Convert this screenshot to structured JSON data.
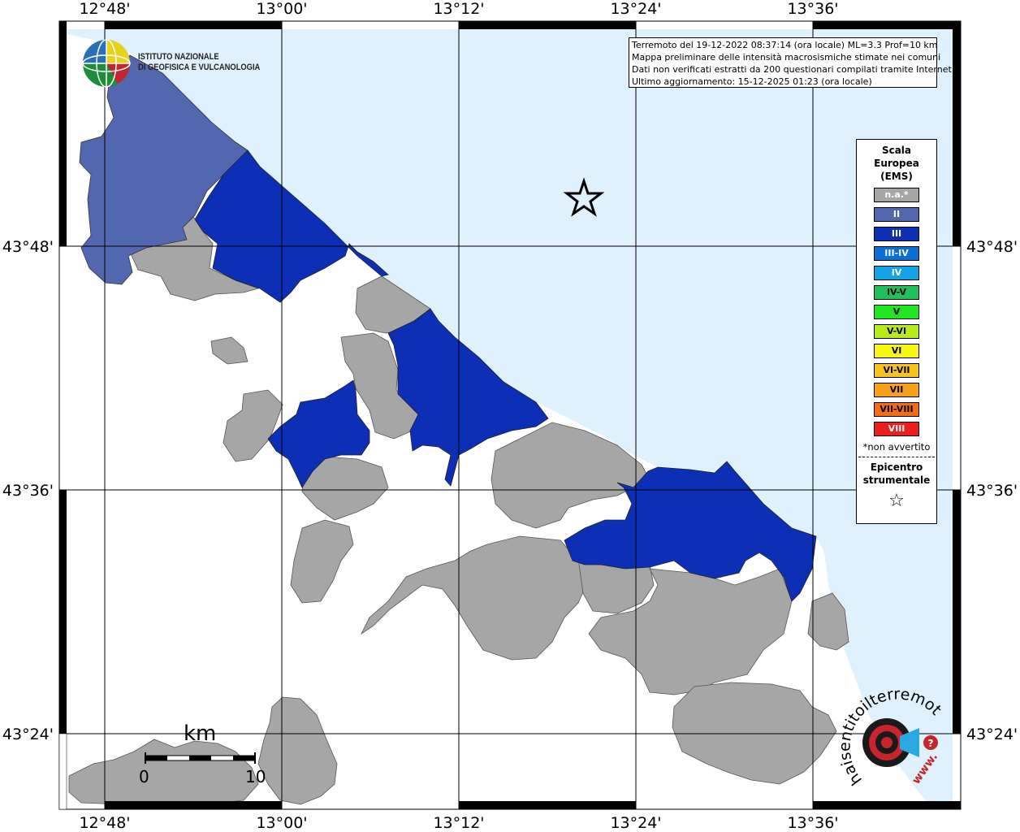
{
  "map": {
    "lon_labels": [
      "12°48'",
      "13°00'",
      "13°12'",
      "13°24'",
      "13°36'"
    ],
    "lat_labels": [
      "43°48'",
      "43°36'",
      "43°24'"
    ],
    "colors": {
      "sea": "#dff1fc",
      "na_fill": "#a6a6a6",
      "ii_fill": "#5366b0",
      "iii_fill": "#0d2fb5",
      "frame": "#000000"
    }
  },
  "logo": {
    "line1": "ISTITUTO NAZIONALE",
    "line2": "DI GEOFISICA E VULCANOLOGIA"
  },
  "info": {
    "line1": "Terremoto del 19-12-2022 08:37:14 (ora locale) ML=3.3 Prof=10 km",
    "line2": "Mappa preliminare delle intensità macrosismiche stimate nei comuni",
    "line3": "Dati non verificati estratti da 200 questionari compilati tramite Internet.",
    "line4": "Ultimo aggiornamento: 15-12-2025 01:23 (ora locale)"
  },
  "legend": {
    "title_line1": "Scala",
    "title_line2": "Europea",
    "title_line3": "(EMS)",
    "items": [
      {
        "label": "n.a.*",
        "color": "#a6a6a6",
        "text": "#ffffff"
      },
      {
        "label": "II",
        "color": "#5366b0",
        "text": "#ffffff"
      },
      {
        "label": "III",
        "color": "#0d2fb5",
        "text": "#ffffff"
      },
      {
        "label": "III-IV",
        "color": "#0a6fd6",
        "text": "#ffffff"
      },
      {
        "label": "IV",
        "color": "#16a2e6",
        "text": "#ffffff"
      },
      {
        "label": "IV-V",
        "color": "#1fc25a",
        "text": "#000000"
      },
      {
        "label": "V",
        "color": "#22e622",
        "text": "#000000"
      },
      {
        "label": "V-VI",
        "color": "#b7ec1a",
        "text": "#000000"
      },
      {
        "label": "VI",
        "color": "#f7f714",
        "text": "#000000"
      },
      {
        "label": "VI-VII",
        "color": "#f8c41c",
        "text": "#000000"
      },
      {
        "label": "VII",
        "color": "#f8a019",
        "text": "#000000"
      },
      {
        "label": "VII-VIII",
        "color": "#f76c12",
        "text": "#000000"
      },
      {
        "label": "VIII",
        "color": "#ee1d1d",
        "text": "#ffffff"
      }
    ],
    "note": "*non avvertito",
    "epicenter_line1": "Epicentro",
    "epicenter_line2": "strumentale"
  },
  "scale_bar": {
    "unit": "km",
    "start": "0",
    "end": "10"
  },
  "haisentito": {
    "text": "haisentitoilterremoto.it",
    "www": "www."
  }
}
